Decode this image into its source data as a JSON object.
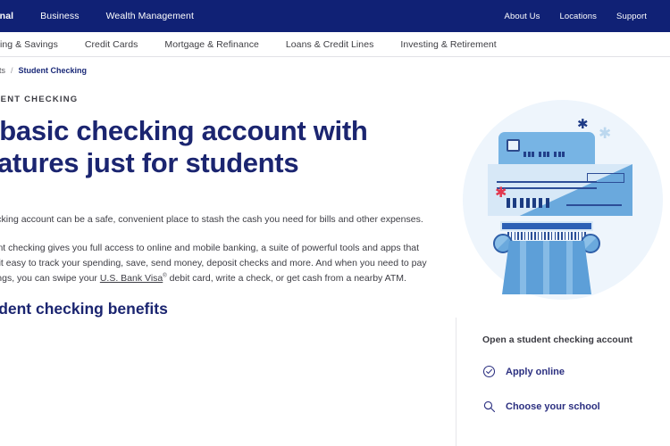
{
  "topnav": {
    "left_items": [
      {
        "label": "Personal",
        "active": true
      },
      {
        "label": "Business",
        "active": false
      },
      {
        "label": "Wealth Management",
        "active": false
      }
    ],
    "right_items": [
      {
        "label": "About Us"
      },
      {
        "label": "Locations"
      },
      {
        "label": "Support"
      }
    ],
    "bg_color": "#102175"
  },
  "subnav": {
    "items": [
      {
        "label": "Checking & Savings"
      },
      {
        "label": "Credit Cards"
      },
      {
        "label": "Mortgage & Refinance"
      },
      {
        "label": "Loans & Credit Lines"
      },
      {
        "label": "Investing & Retirement"
      }
    ]
  },
  "breadcrumb": {
    "parent": "accounts",
    "separator": "/",
    "current": "Student Checking"
  },
  "hero": {
    "eyebrow": "STUDENT CHECKING",
    "headline": "A basic checking account with features just for students",
    "illustration": {
      "name": "student-banking-illustration",
      "circle_color": "#eef5fc",
      "card_color": "#77b4e4",
      "card_stripe_color": "#cf3145",
      "check_color": "#d7e8f7",
      "check_accent_color": "#6aa9dd",
      "column_color": "#5d9fd8",
      "column_cap_color": "#2c60b5",
      "sparkle_red": "#e2384f",
      "sparkle_navy": "#1d3a86",
      "sparkle_pale": "#bcd8ef"
    }
  },
  "body": {
    "paragraph1": "A checking account can be a safe, convenient place to stash the cash you need for bills and other expenses.",
    "paragraph2_part1": "Student checking gives you full access to online and mobile banking, a suite of powerful tools and apps that make it easy to track your spending, save, send money, deposit checks and more. And when you need to pay for things, you can swipe your ",
    "paragraph2_link": "U.S. Bank Visa",
    "paragraph2_sup": "®",
    "paragraph2_part2": " debit card, write a check, or get cash from a nearby ATM.",
    "section_title": "Student checking benefits"
  },
  "rail": {
    "title": "Open a student checking account",
    "links": [
      {
        "label": "Apply online",
        "icon": "check-circle-icon"
      },
      {
        "label": "Choose your school",
        "icon": "search-icon"
      }
    ],
    "link_color": "#2b2f80"
  }
}
